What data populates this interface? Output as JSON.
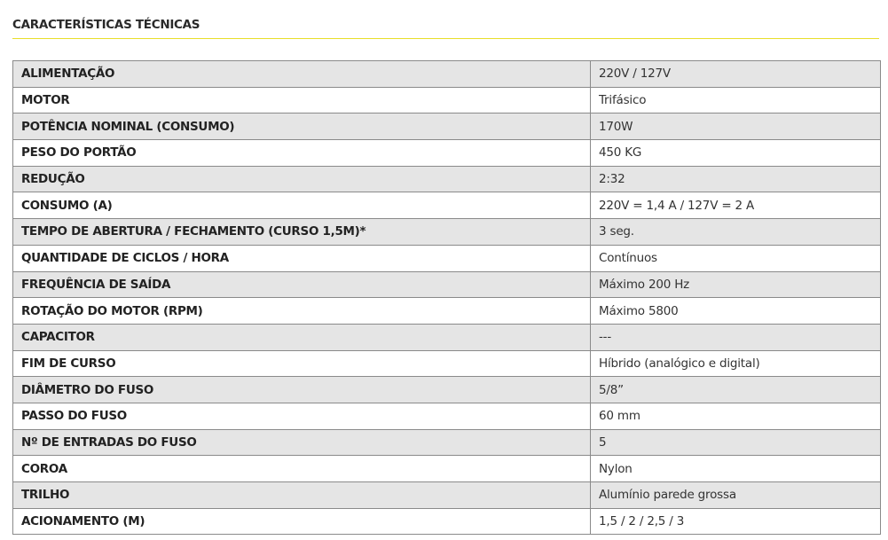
{
  "section": {
    "title": "CARACTERÍSTICAS TÉCNICAS",
    "accent_color": "#e8de2a"
  },
  "specs": {
    "rows": [
      {
        "label": "ALIMENTAÇÃO",
        "value": "220V / 127V"
      },
      {
        "label": "MOTOR",
        "value": "Trifásico"
      },
      {
        "label": "POTÊNCIA NOMINAL (CONSUMO)",
        "value": "170W"
      },
      {
        "label": "PESO DO PORTÃO",
        "value": "450 KG"
      },
      {
        "label": "REDUÇÃO",
        "value": "2:32"
      },
      {
        "label": "CONSUMO (A)",
        "value": "220V = 1,4 A / 127V = 2 A"
      },
      {
        "label": "TEMPO DE ABERTURA / FECHAMENTO (CURSO 1,5M)*",
        "value": "3 seg."
      },
      {
        "label": "QUANTIDADE DE CICLOS / HORA",
        "value": "Contínuos"
      },
      {
        "label": "FREQUÊNCIA DE SAÍDA",
        "value": "Máximo 200 Hz"
      },
      {
        "label": "ROTAÇÃO DO MOTOR (RPM)",
        "value": "Máximo 5800"
      },
      {
        "label": "CAPACITOR",
        "value": "---"
      },
      {
        "label": "FIM DE CURSO",
        "value": "Híbrido (analógico e digital)"
      },
      {
        "label": "DIÂMETRO DO FUSO",
        "value": "5/8”"
      },
      {
        "label": "PASSO DO FUSO",
        "value": "60 mm"
      },
      {
        "label": "Nº DE ENTRADAS DO FUSO",
        "value": "5"
      },
      {
        "label": "COROA",
        "value": "Nylon"
      },
      {
        "label": "TRILHO",
        "value": "Alumínio parede grossa"
      },
      {
        "label": "ACIONAMENTO (M)",
        "value": "1,5 / 2 / 2,5 / 3"
      }
    ]
  }
}
